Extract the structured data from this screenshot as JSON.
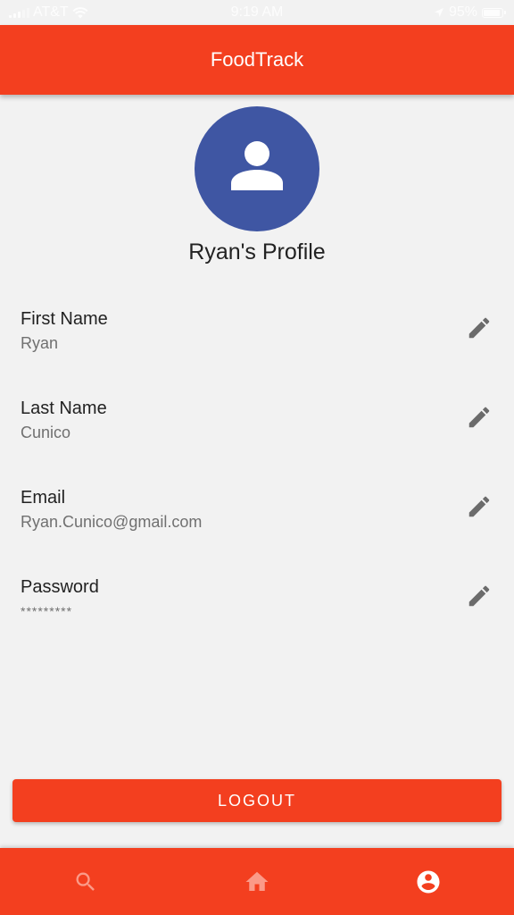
{
  "status_bar": {
    "carrier": "AT&T",
    "time": "9:19 AM",
    "battery": "95%",
    "icons": [
      "signal-icon",
      "wifi-icon",
      "location-icon",
      "battery-icon"
    ]
  },
  "app_bar": {
    "title": "FoodTrack"
  },
  "profile": {
    "avatar_icon": "person-icon",
    "title": "Ryan's Profile"
  },
  "fields": [
    {
      "label": "First Name",
      "value": "Ryan"
    },
    {
      "label": "Last Name",
      "value": "Cunico"
    },
    {
      "label": "Email",
      "value": "Ryan.Cunico@gmail.com"
    },
    {
      "label": "Password",
      "value": "*********"
    }
  ],
  "logout_label": "LOGOUT",
  "bottom_nav": {
    "items": [
      {
        "icon": "search-icon",
        "active": false
      },
      {
        "icon": "home-icon",
        "active": false
      },
      {
        "icon": "account-icon",
        "active": true
      }
    ]
  },
  "colors": {
    "primary": "#f33f1f",
    "avatar": "#3f56a3",
    "background": "#f2f2f2",
    "inactive_nav_icon": "#fb9a88",
    "active_nav_icon": "#ffffff",
    "edit_icon": "#6b6b6b"
  }
}
